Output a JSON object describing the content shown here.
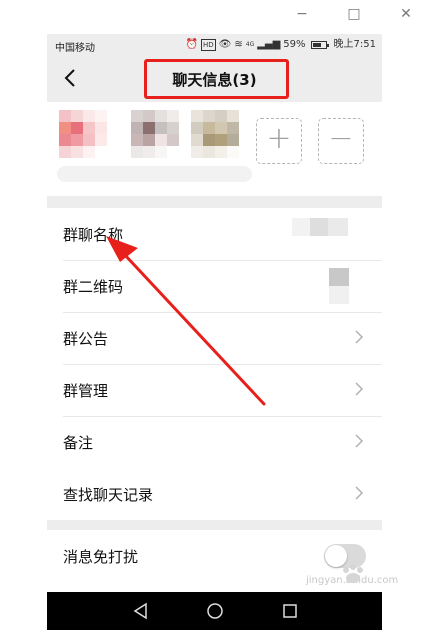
{
  "window": {
    "minimize_glyph": "−",
    "maximize_glyph": "□",
    "close_glyph": "✕"
  },
  "status_bar": {
    "carrier": "中国移动",
    "battery": "59%",
    "time": "晚上7:51",
    "signal_label": "4G",
    "hd_label": "HD"
  },
  "header": {
    "title": "聊天信息(3)",
    "back_icon": "chevron-left-icon"
  },
  "members": {
    "add_label": "+",
    "remove_label": "−"
  },
  "settings_group_1": [
    {
      "label": "群聊名称"
    },
    {
      "label": "群二维码"
    },
    {
      "label": "群公告"
    },
    {
      "label": "群管理"
    },
    {
      "label": "备注"
    }
  ],
  "settings_group_2": [
    {
      "label": "查找聊天记录"
    }
  ],
  "settings_group_3": [
    {
      "label": "消息免打扰",
      "toggle_on": false
    }
  ],
  "watermark": {
    "text": "jingyan.baidu.com"
  },
  "colors": {
    "highlight": "#e8201b",
    "background": "#ededed"
  }
}
